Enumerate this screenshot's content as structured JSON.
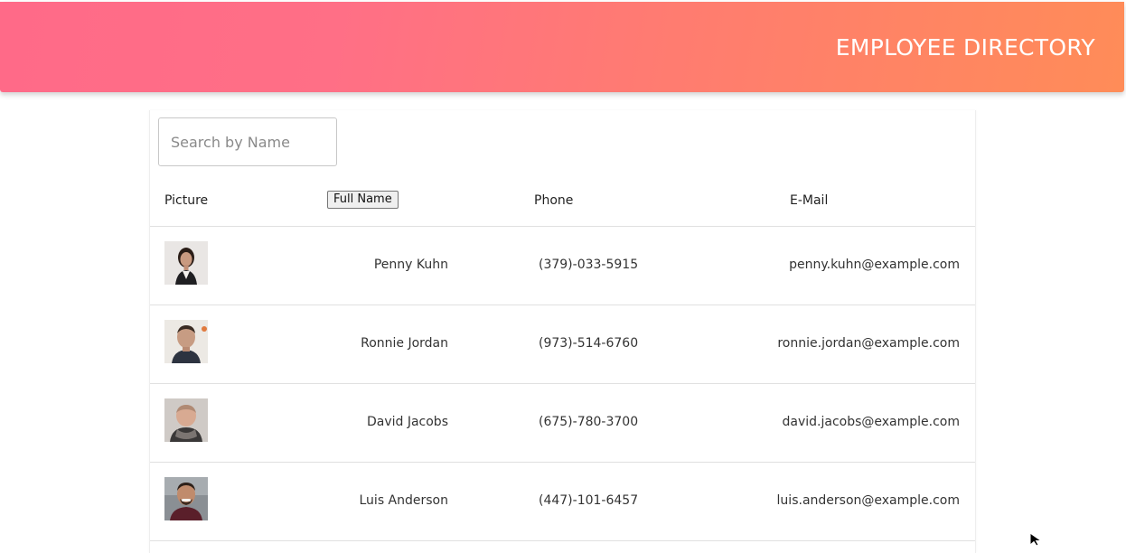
{
  "header": {
    "title": "EMPLOYEE DIRECTORY"
  },
  "search": {
    "placeholder": "Search by Name",
    "value": ""
  },
  "table": {
    "columns": {
      "picture": "Picture",
      "name": "Full Name",
      "phone": "Phone",
      "email": "E-Mail"
    },
    "rows": [
      {
        "name": "Penny Kuhn",
        "phone": "(379)-033-5915",
        "email": "penny.kuhn@example.com"
      },
      {
        "name": "Ronnie Jordan",
        "phone": "(973)-514-6760",
        "email": "ronnie.jordan@example.com"
      },
      {
        "name": "David Jacobs",
        "phone": "(675)-780-3700",
        "email": "david.jacobs@example.com"
      },
      {
        "name": "Luis Anderson",
        "phone": "(447)-101-6457",
        "email": "luis.anderson@example.com"
      }
    ]
  },
  "colors": {
    "header_gradient_start": "#ff6a88",
    "header_gradient_end": "#ff8c58",
    "header_text": "#ffffff"
  }
}
